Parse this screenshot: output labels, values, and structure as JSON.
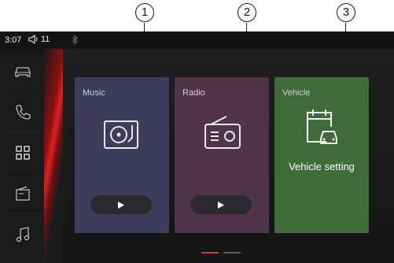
{
  "callouts": [
    "1",
    "2",
    "3"
  ],
  "status": {
    "time": "3:07",
    "volume": "11"
  },
  "sidebar": {
    "items": [
      {
        "icon": "car-icon"
      },
      {
        "icon": "phone-icon"
      },
      {
        "icon": "apps-grid-icon"
      },
      {
        "icon": "radio-icon"
      },
      {
        "icon": "music-note-icon"
      }
    ]
  },
  "cards": {
    "music": {
      "title": "Music",
      "color": "#3e3c5a"
    },
    "radio": {
      "title": "Radio",
      "color": "#50344a"
    },
    "vehicle": {
      "title": "Vehicle",
      "label": "Vehicle setting",
      "color": "#3f6b3a"
    }
  },
  "pager": {
    "pages": 2,
    "active": 1,
    "active_color": "#e03030"
  }
}
